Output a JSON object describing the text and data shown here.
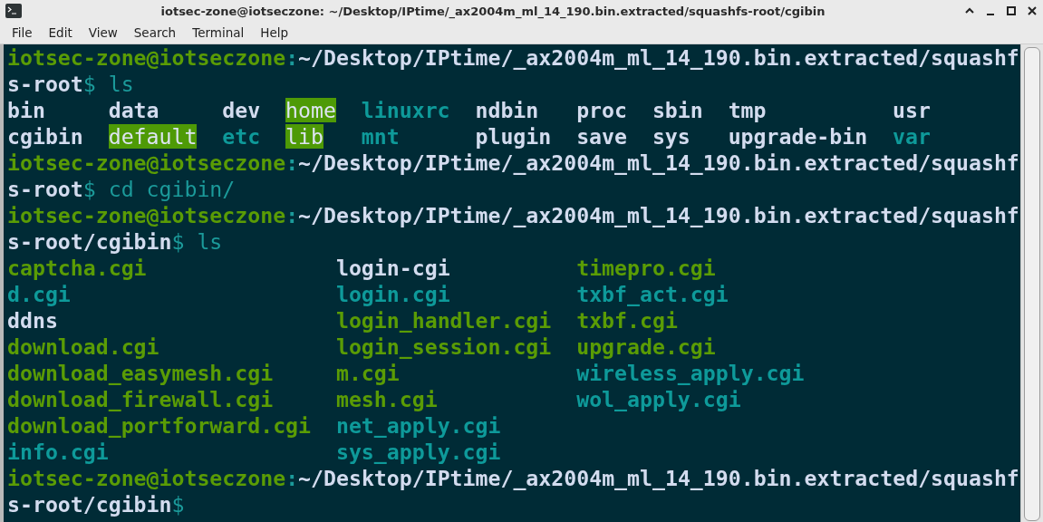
{
  "window": {
    "title": "iotsec-zone@iotseczone: ~/Desktop/IPtime/_ax2004m_ml_14_190.bin.extracted/squashfs-root/cgibin"
  },
  "menu": [
    "File",
    "Edit",
    "View",
    "Search",
    "Terminal",
    "Help"
  ],
  "terminal": [
    {
      "kind": "line",
      "segments": [
        {
          "kind": "user",
          "text": "iotsec-zone@iotseczone"
        },
        {
          "kind": "colon",
          "text": ":"
        },
        {
          "kind": "path",
          "text": "~/Desktop/IPtime/_ax2004m_ml_14_190.bin.extracted/squashf"
        }
      ]
    },
    {
      "kind": "line",
      "segments": [
        {
          "kind": "path",
          "text": "s-root"
        },
        {
          "kind": "sigil",
          "text": "$"
        },
        {
          "kind": "command",
          "text": "ls"
        }
      ]
    },
    {
      "kind": "listing",
      "rows": [
        [
          {
            "name": "bin",
            "kind": "dir"
          },
          {
            "name": "data",
            "kind": "dir"
          },
          {
            "name": "dev",
            "kind": "dir"
          },
          {
            "name": "home",
            "kind": "sticky"
          },
          {
            "name": "linuxrc",
            "kind": "link"
          },
          {
            "name": "ndbin",
            "kind": "dir"
          },
          {
            "name": "proc",
            "kind": "dir"
          },
          {
            "name": "sbin",
            "kind": "dir"
          },
          {
            "name": "tmp",
            "kind": "dir"
          },
          {
            "name": "usr",
            "kind": "dir"
          }
        ],
        [
          {
            "name": "cgibin",
            "kind": "dir"
          },
          {
            "name": "default",
            "kind": "sticky"
          },
          {
            "name": "etc",
            "kind": "link"
          },
          {
            "name": "lib",
            "kind": "sticky"
          },
          {
            "name": "mnt",
            "kind": "link"
          },
          {
            "name": "plugin",
            "kind": "dir"
          },
          {
            "name": "save",
            "kind": "dir"
          },
          {
            "name": "sys",
            "kind": "dir"
          },
          {
            "name": "upgrade-bin",
            "kind": "dir"
          },
          {
            "name": "var",
            "kind": "link"
          }
        ]
      ]
    },
    {
      "kind": "line",
      "segments": [
        {
          "kind": "user",
          "text": "iotsec-zone@iotseczone"
        },
        {
          "kind": "colon",
          "text": ":"
        },
        {
          "kind": "path",
          "text": "~/Desktop/IPtime/_ax2004m_ml_14_190.bin.extracted/squashf"
        }
      ]
    },
    {
      "kind": "line",
      "segments": [
        {
          "kind": "path",
          "text": "s-root"
        },
        {
          "kind": "sigil",
          "text": "$"
        },
        {
          "kind": "command",
          "text": "cd cgibin/"
        }
      ]
    },
    {
      "kind": "line",
      "segments": [
        {
          "kind": "user",
          "text": "iotsec-zone@iotseczone"
        },
        {
          "kind": "colon",
          "text": ":"
        },
        {
          "kind": "path",
          "text": "~/Desktop/IPtime/_ax2004m_ml_14_190.bin.extracted/squashf"
        }
      ]
    },
    {
      "kind": "line",
      "segments": [
        {
          "kind": "path",
          "text": "s-root/cgibin"
        },
        {
          "kind": "sigil",
          "text": "$"
        },
        {
          "kind": "command",
          "text": "ls"
        }
      ]
    },
    {
      "kind": "listing",
      "rows": [
        [
          {
            "name": "captcha.cgi",
            "kind": "exec"
          },
          {
            "name": "login-cgi",
            "kind": "file"
          },
          {
            "name": "timepro.cgi",
            "kind": "exec"
          }
        ],
        [
          {
            "name": "d.cgi",
            "kind": "link"
          },
          {
            "name": "login.cgi",
            "kind": "link"
          },
          {
            "name": "txbf_act.cgi",
            "kind": "link"
          }
        ],
        [
          {
            "name": "ddns",
            "kind": "file"
          },
          {
            "name": "login_handler.cgi",
            "kind": "exec"
          },
          {
            "name": "txbf.cgi",
            "kind": "exec"
          }
        ],
        [
          {
            "name": "download.cgi",
            "kind": "exec"
          },
          {
            "name": "login_session.cgi",
            "kind": "exec"
          },
          {
            "name": "upgrade.cgi",
            "kind": "exec"
          }
        ],
        [
          {
            "name": "download_easymesh.cgi",
            "kind": "exec"
          },
          {
            "name": "m.cgi",
            "kind": "exec"
          },
          {
            "name": "wireless_apply.cgi",
            "kind": "link"
          }
        ],
        [
          {
            "name": "download_firewall.cgi",
            "kind": "exec"
          },
          {
            "name": "mesh.cgi",
            "kind": "exec"
          },
          {
            "name": "wol_apply.cgi",
            "kind": "link"
          }
        ],
        [
          {
            "name": "download_portforward.cgi",
            "kind": "exec"
          },
          {
            "name": "net_apply.cgi",
            "kind": "link"
          }
        ],
        [
          {
            "name": "info.cgi",
            "kind": "link"
          },
          {
            "name": "sys_apply.cgi",
            "kind": "link"
          }
        ]
      ]
    },
    {
      "kind": "line",
      "segments": [
        {
          "kind": "user",
          "text": "iotsec-zone@iotseczone"
        },
        {
          "kind": "colon",
          "text": ":"
        },
        {
          "kind": "path",
          "text": "~/Desktop/IPtime/_ax2004m_ml_14_190.bin.extracted/squashf"
        }
      ]
    },
    {
      "kind": "line",
      "segments": [
        {
          "kind": "path",
          "text": "s-root/cgibin"
        },
        {
          "kind": "sigil",
          "text": "$"
        }
      ]
    }
  ]
}
